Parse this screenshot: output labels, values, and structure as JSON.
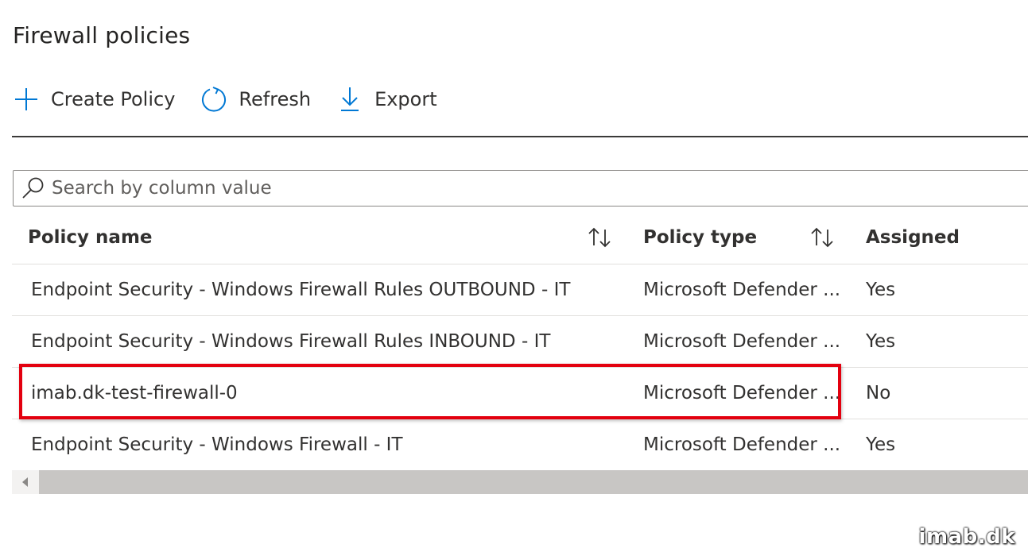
{
  "page": {
    "title": "Firewall policies"
  },
  "toolbar": {
    "create_label": "Create Policy",
    "refresh_label": "Refresh",
    "export_label": "Export"
  },
  "search": {
    "placeholder": "Search by column value"
  },
  "table": {
    "columns": {
      "name": "Policy name",
      "type": "Policy type",
      "assigned": "Assigned"
    },
    "rows": [
      {
        "name": "Endpoint Security - Windows Firewall Rules OUTBOUND - IT",
        "type": "Microsoft Defender ...",
        "assigned": "Yes"
      },
      {
        "name": "Endpoint Security - Windows Firewall Rules INBOUND - IT",
        "type": "Microsoft Defender ...",
        "assigned": "Yes"
      },
      {
        "name": "imab.dk-test-firewall-0",
        "type": "Microsoft Defender ...",
        "assigned": "No"
      },
      {
        "name": "Endpoint Security - Windows Firewall - IT",
        "type": "Microsoft Defender ...",
        "assigned": "Yes"
      }
    ]
  },
  "watermark": "imab.dk",
  "colors": {
    "accent": "#0078d4",
    "highlight": "#e3000f",
    "text": "#323130"
  },
  "icons": {
    "create": "plus-icon",
    "refresh": "refresh-icon",
    "export": "download-icon",
    "search": "search-icon",
    "sort": "sort-arrows-icon",
    "scroll_left": "chevron-left-icon"
  }
}
